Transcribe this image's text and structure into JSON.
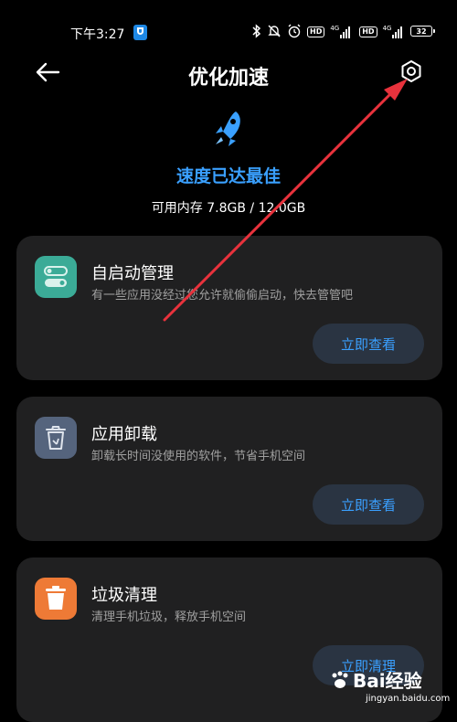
{
  "status_bar": {
    "time": "下午3:27",
    "network_label_1": "4G",
    "network_label_2": "4G",
    "hd_label_1": "HD",
    "hd_label_2": "HD",
    "battery": "32"
  },
  "header": {
    "title": "优化加速"
  },
  "hero": {
    "status": "速度已达最佳",
    "memory": "可用内存 7.8GB / 12.0GB"
  },
  "cards": [
    {
      "title": "自启动管理",
      "description": "有一些应用没经过您允许就偷偷启动，快去管管吧",
      "button": "立即查看",
      "icon": "toggle-switches-icon",
      "icon_color": "#3bab97"
    },
    {
      "title": "应用卸载",
      "description": "卸载长时间没使用的软件，节省手机空间",
      "button": "立即查看",
      "icon": "uninstall-bin-icon",
      "icon_color": "#55647d"
    },
    {
      "title": "垃圾清理",
      "description": "清理手机垃圾，释放手机空间",
      "button": "立即清理",
      "icon": "trash-icon",
      "icon_color": "#ee7a36"
    }
  ],
  "watermark": {
    "main": "Bai经验",
    "sub": "jingyan.baidu.com"
  },
  "colors": {
    "accent": "#3aa0ff",
    "annotation_arrow": "#e8323c"
  }
}
